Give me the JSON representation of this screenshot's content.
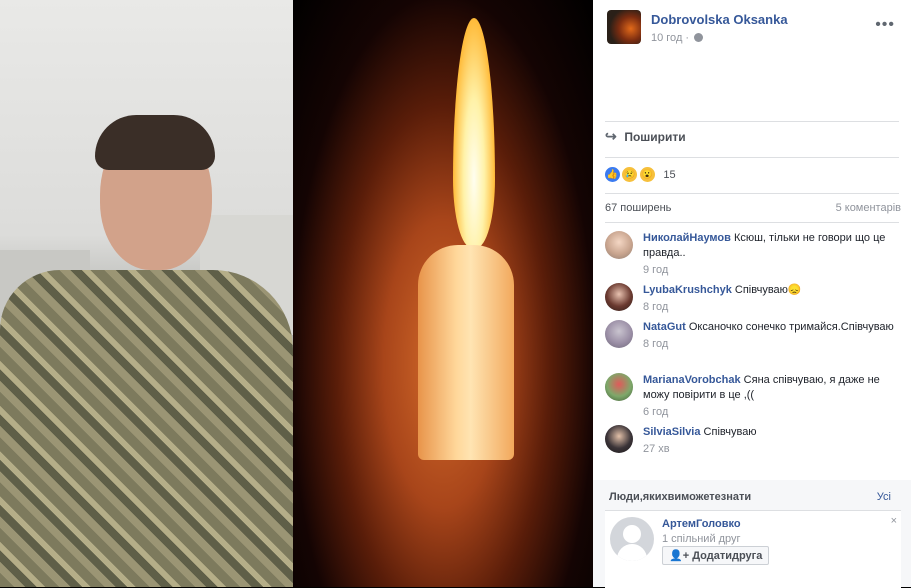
{
  "post": {
    "author": "Dobrovolska Oksanka",
    "time": "10 год",
    "time_sep": "·",
    "more": "•••",
    "share_label": "Поширити",
    "reactions_count": "15",
    "shares_label": "67 поширень",
    "comments_label": "5 коментарів"
  },
  "comments": [
    {
      "name": "НиколайНаумов",
      "text": "Ксюш, тільки не говори що це правда..",
      "time": "9 год"
    },
    {
      "name": "LyubaKrushchyk",
      "text": "Співчуваю😞",
      "time": "8 год"
    },
    {
      "name": "NataGut",
      "text": "Оксаночко сонечко тримайся.Співчуваю",
      "time": "8 год"
    },
    {
      "name": "MarianaVorobchak",
      "text": "Сяна співчуваю, я даже не можу повірити в це ,((",
      "time": "6 год"
    },
    {
      "name": "SilviaSilvia",
      "text": "Співчуваю",
      "time": "27 хв"
    }
  ],
  "suggestions": {
    "title": "Люди,якихвиможетезнати",
    "all_label": "Усі",
    "person_name": "АртемГоловко",
    "mutual": "1 спільний друг",
    "add_label": "Додатидруга",
    "close": "×"
  },
  "icons": {
    "like": "like-icon",
    "sad": "sad-icon",
    "wow": "wow-icon",
    "share": "share-icon",
    "globe": "globe-icon",
    "more": "more-icon"
  }
}
